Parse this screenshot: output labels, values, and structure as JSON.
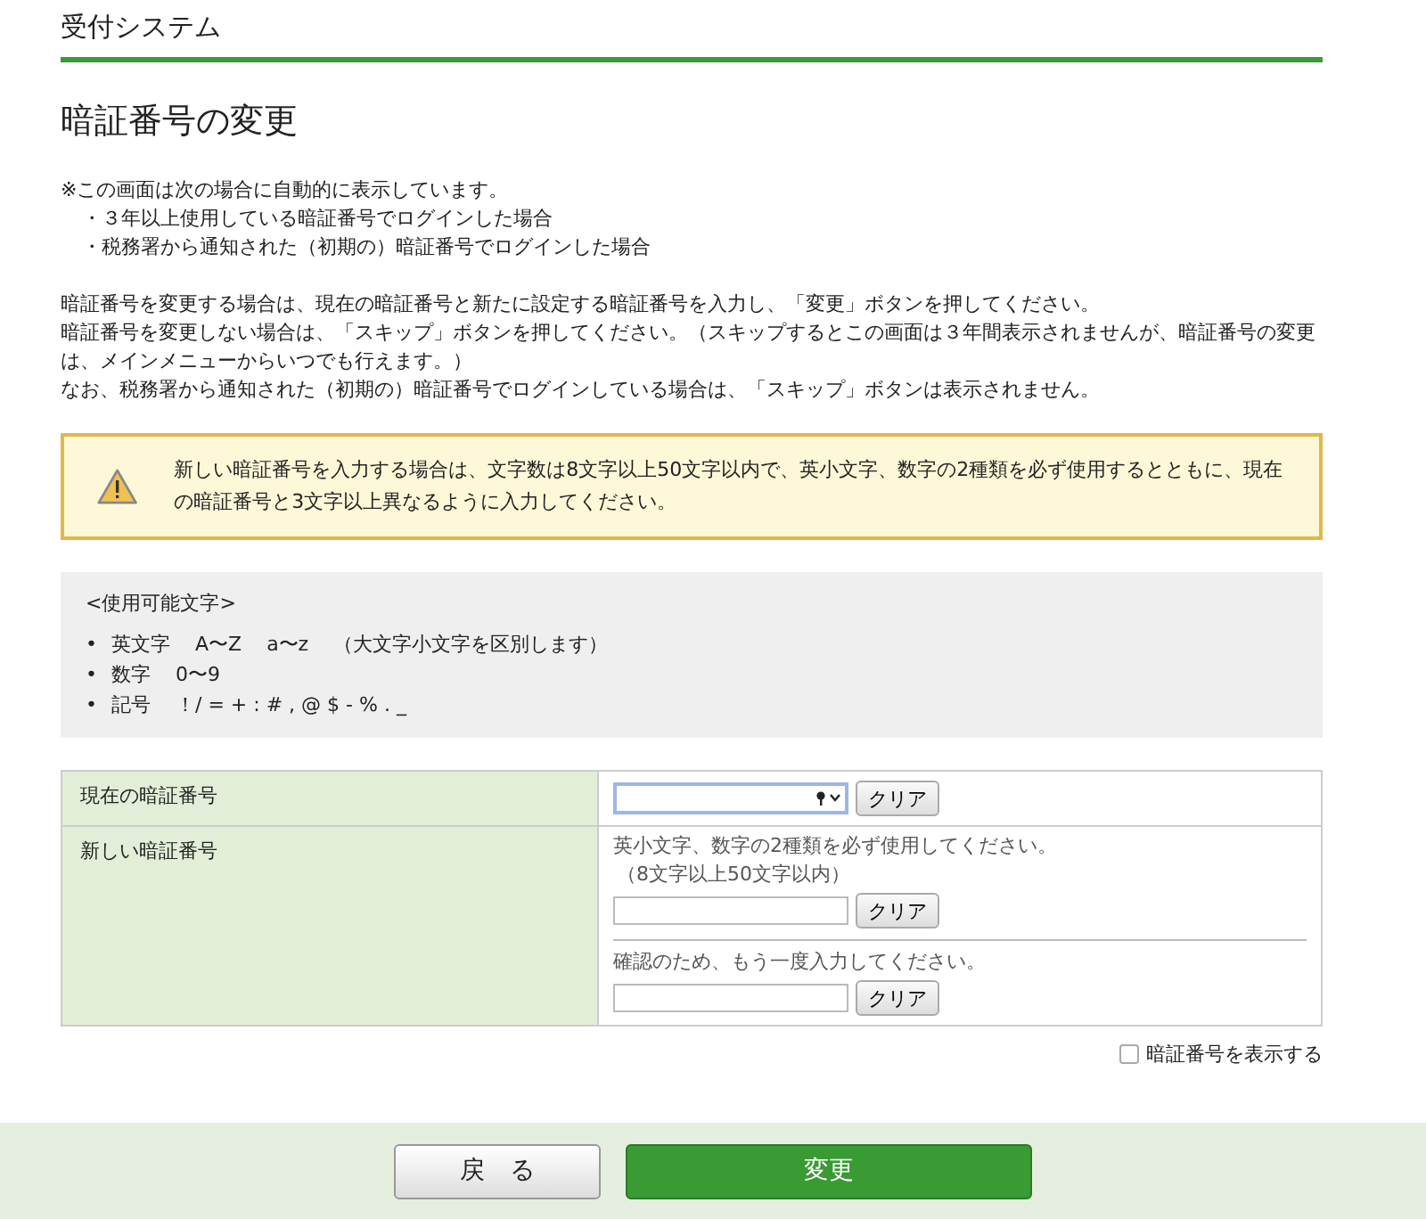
{
  "header": {
    "title": "受付システム"
  },
  "page_title": "暗証番号の変更",
  "intro": {
    "lead": "※この画面は次の場合に自動的に表示しています。",
    "bullets": [
      "・３年以上使用している暗証番号でログインした場合",
      "・税務署から通知された（初期の）暗証番号でログインした場合"
    ]
  },
  "instructions": [
    "暗証番号を変更する場合は、現在の暗証番号と新たに設定する暗証番号を入力し、「変更」ボタンを押してください。",
    "暗証番号を変更しない場合は、「スキップ」ボタンを押してください。（スキップするとこの画面は３年間表示されませんが、暗証番号の変更は、メインメニューからいつでも行えます。）",
    "なお、税務署から通知された（初期の）暗証番号でログインしている場合は、「スキップ」ボタンは表示されません。"
  ],
  "warning": {
    "text": "新しい暗証番号を入力する場合は、文字数は8文字以上50文字以内で、英小文字、数字の2種類を必ず使用するとともに、現在の暗証番号と3文字以上異なるように入力してください。"
  },
  "charset": {
    "heading": "<使用可能文字>",
    "items": [
      {
        "marker": "•",
        "label": "英文字",
        "values": [
          "A〜Z",
          "a〜z",
          "（大文字小文字を区別します）"
        ]
      },
      {
        "marker": "•",
        "label": "数字",
        "values": [
          "0〜9"
        ]
      },
      {
        "marker": "•",
        "label": "記号",
        "values": [
          "！/ = + : # , @ $ - % . _"
        ]
      }
    ]
  },
  "form": {
    "rows": [
      {
        "label": "現在の暗証番号",
        "fields": [
          {
            "focused": true,
            "clear_button": "クリア"
          }
        ]
      },
      {
        "label": "新しい暗証番号",
        "fields": [
          {
            "hint": "英小文字、数字の2種類を必ず使用してください。",
            "note": "（8文字以上50文字以内）",
            "focused": false,
            "clear_button": "クリア"
          },
          {
            "hint": "確認のため、もう一度入力してください。",
            "focused": false,
            "clear_button": "クリア"
          }
        ]
      }
    ]
  },
  "show_password": {
    "label": "暗証番号を表示する",
    "checked": false
  },
  "buttons": [
    {
      "label": "戻　る",
      "kind": "secondary"
    },
    {
      "label": "変更",
      "kind": "primary"
    }
  ]
}
